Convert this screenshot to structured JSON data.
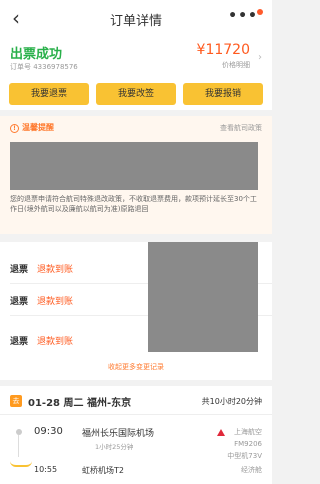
{
  "nav": {
    "title": "订单详情",
    "back_icon": "chevron-left-icon",
    "more_icon": "more-icon"
  },
  "status": {
    "text": "出票成功",
    "order_no": "订单号 4336978576",
    "price": "¥11720",
    "price_detail": "价格明细",
    "buttons": [
      "我要退票",
      "我要改签",
      "我要报销"
    ]
  },
  "notice": {
    "title": "温馨提醒",
    "link": "查看航司政策",
    "text": "您的退票申请符合航司特殊退改政策，不收取退票费用，款项预计延长至30个工作日(境外航司以及廉航以航司为准)原路退回"
  },
  "refunds": {
    "rows": [
      {
        "label": "退票",
        "status": "退款到账"
      },
      {
        "label": "退票",
        "status": "退款到账"
      },
      {
        "label": "退票",
        "status": "退款到账"
      }
    ],
    "more": "收起更多变更记录"
  },
  "flight": {
    "badge": "去",
    "route": "01-28 周二 福州-东京",
    "duration": "共10小时20分钟",
    "dep_time": "09:30",
    "dep_airport": "福州长乐国际机场",
    "mid": "1小时25分钟",
    "arr_time": "10:55",
    "arr_airport": "虹桥机场T2",
    "airline": "上海航空",
    "flight_no": "FM9206",
    "plane_type": "中型机73V",
    "cabin": "经济舱"
  },
  "colors": {
    "accent": "#f9c233",
    "success": "#29b04a",
    "price": "#ff5a1f"
  }
}
